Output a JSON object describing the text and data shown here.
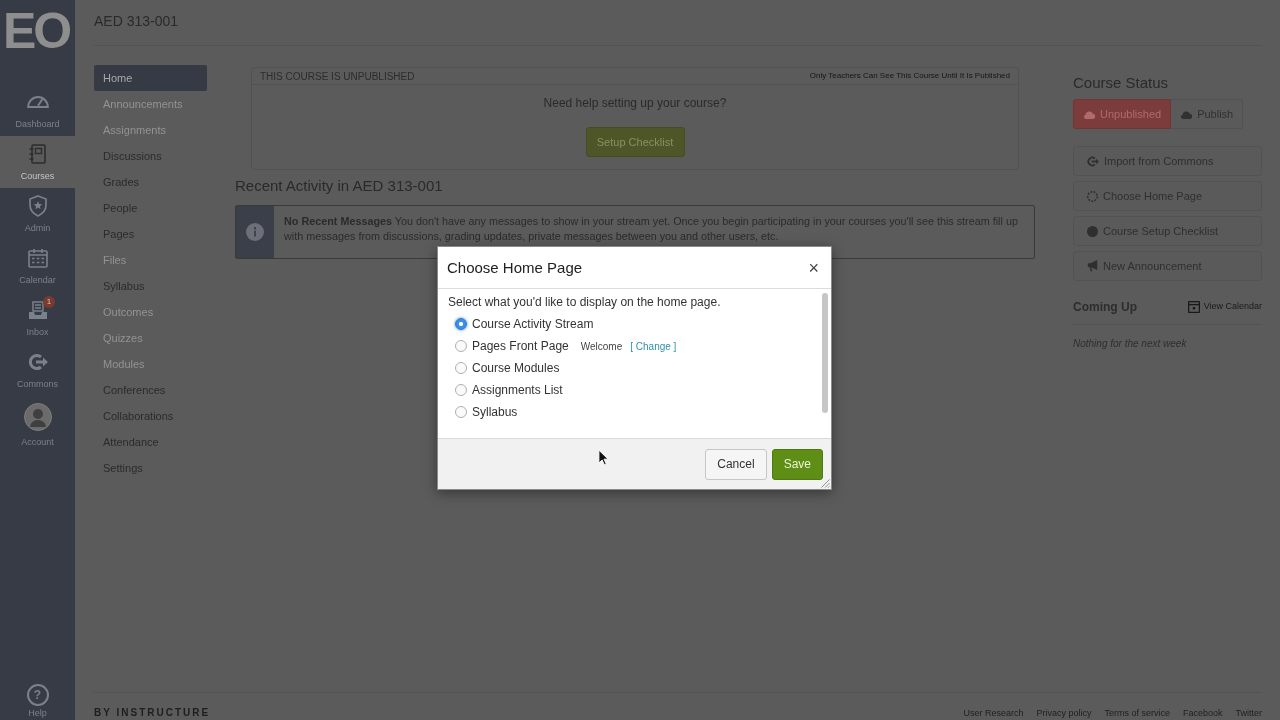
{
  "global_nav": {
    "logo_text": "EO",
    "items": [
      {
        "kind": "icon",
        "label": "Dashboard",
        "selected": false
      },
      {
        "kind": "icon",
        "label": "Courses",
        "selected": true
      },
      {
        "kind": "icon",
        "label": "Admin",
        "selected": false
      },
      {
        "kind": "icon",
        "label": "Calendar",
        "selected": false
      },
      {
        "kind": "icon",
        "label": "Inbox",
        "selected": false,
        "badge": "1"
      },
      {
        "kind": "icon",
        "label": "Commons",
        "selected": false
      },
      {
        "kind": "avatar",
        "label": "Account",
        "selected": false
      }
    ],
    "help": {
      "symbol": "?",
      "label": "Help"
    }
  },
  "course_title": "AED 313-001",
  "course_nav": [
    {
      "label": "Home",
      "selected": true,
      "hidden": false
    },
    {
      "label": "Announcements",
      "selected": false,
      "hidden": true
    },
    {
      "label": "Assignments",
      "selected": false,
      "hidden": true
    },
    {
      "label": "Discussions",
      "selected": false,
      "hidden": false
    },
    {
      "label": "Grades",
      "selected": false,
      "hidden": false
    },
    {
      "label": "People",
      "selected": false,
      "hidden": false
    },
    {
      "label": "Pages",
      "selected": false,
      "hidden": false
    },
    {
      "label": "Files",
      "selected": false,
      "hidden": true
    },
    {
      "label": "Syllabus",
      "selected": false,
      "hidden": false
    },
    {
      "label": "Outcomes",
      "selected": false,
      "hidden": true
    },
    {
      "label": "Quizzes",
      "selected": false,
      "hidden": true
    },
    {
      "label": "Modules",
      "selected": false,
      "hidden": true
    },
    {
      "label": "Conferences",
      "selected": false,
      "hidden": false
    },
    {
      "label": "Collaborations",
      "selected": false,
      "hidden": false
    },
    {
      "label": "Attendance",
      "selected": false,
      "hidden": false
    },
    {
      "label": "Settings",
      "selected": false,
      "hidden": false
    }
  ],
  "unpublished_banner": {
    "title": "THIS COURSE IS UNPUBLISHED",
    "note": "Only Teachers Can See This Course Until It Is Published",
    "prompt": "Need help setting up your course?",
    "button": "Setup Checklist"
  },
  "recent_activity": {
    "heading": "Recent Activity in AED 313-001",
    "message": "**No Recent Messages** You don't have any messages to show in your stream yet. Once you begin participating in your courses you'll see this stream fill up with messages from discussions, grading updates, private messages between you and other users, etc."
  },
  "course_status": {
    "heading": "Course Status",
    "buttons": [
      {
        "label": "Unpublished",
        "selected": true
      },
      {
        "label": "Publish",
        "selected": false
      }
    ],
    "actions": [
      "Import from Commons",
      "Choose Home Page",
      "Course Setup Checklist",
      "New Announcement"
    ]
  },
  "coming_up": {
    "heading": "Coming Up",
    "link": "View Calendar",
    "empty_text": "Nothing for the next week"
  },
  "footer": {
    "brand": "BY INSTRUCTURE",
    "links": [
      "User Research",
      "Privacy policy",
      "Terms of service",
      "Facebook",
      "Twitter"
    ]
  },
  "dialog": {
    "title": "Choose Home Page",
    "close": "×",
    "prompt": "Select what you'd like to display on the home page.",
    "options": [
      {
        "label": "Course Activity Stream",
        "selected": true
      },
      {
        "label": "Pages Front Page",
        "selected": false,
        "page": "Welcome",
        "change_link": "[ Change ]"
      },
      {
        "label": "Course Modules",
        "selected": false
      },
      {
        "label": "Assignments List",
        "selected": false
      },
      {
        "label": "Syllabus",
        "selected": false
      }
    ],
    "buttons": [
      {
        "kind": "secondary",
        "label": "Cancel"
      },
      {
        "kind": "primary",
        "label": "Save"
      }
    ]
  }
}
